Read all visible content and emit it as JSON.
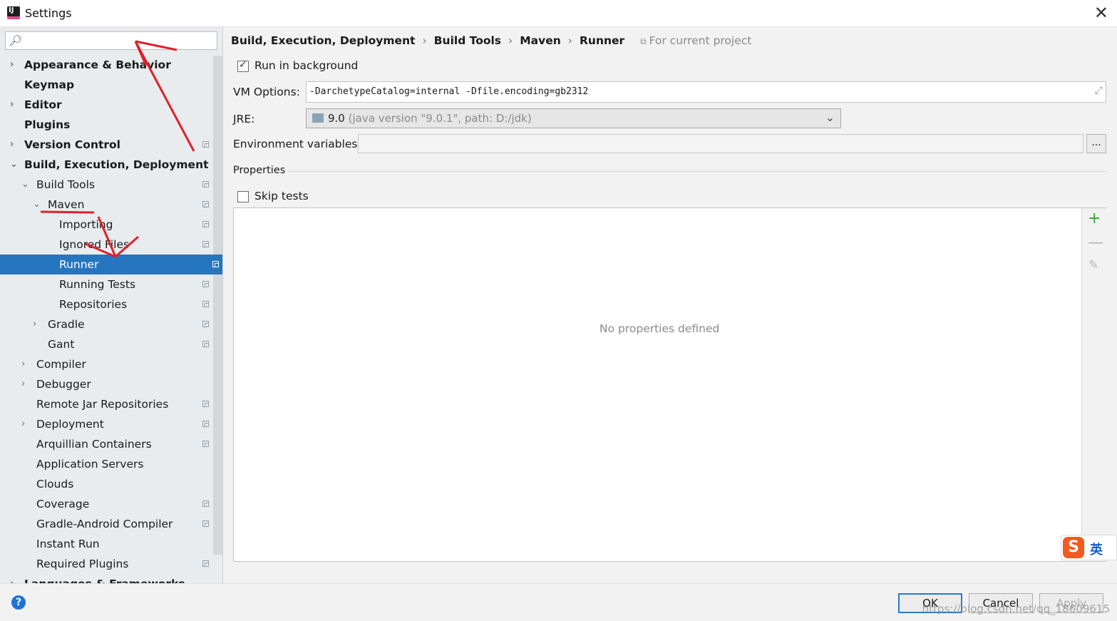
{
  "window": {
    "title": "Settings",
    "close_glyph": "✕"
  },
  "sidebar": {
    "search_placeholder": "",
    "items": [
      {
        "label": "Appearance & Behavior",
        "arrow": "›",
        "bold": true
      },
      {
        "label": "Keymap",
        "bold": true
      },
      {
        "label": "Editor",
        "arrow": "›",
        "bold": true
      },
      {
        "label": "Plugins",
        "bold": true
      },
      {
        "label": "Version Control",
        "arrow": "›",
        "bold": true
      },
      {
        "label": "Build, Execution, Deployment",
        "arrow": "⌄",
        "bold": true
      },
      {
        "label": "Build Tools",
        "arrow": "⌄"
      },
      {
        "label": "Maven",
        "arrow": "⌄"
      },
      {
        "label": "Importing"
      },
      {
        "label": "Ignored Files"
      },
      {
        "label": "Runner",
        "selected": true
      },
      {
        "label": "Running Tests"
      },
      {
        "label": "Repositories"
      },
      {
        "label": "Gradle",
        "arrow": "›"
      },
      {
        "label": "Gant"
      },
      {
        "label": "Compiler",
        "arrow": "›"
      },
      {
        "label": "Debugger",
        "arrow": "›"
      },
      {
        "label": "Remote Jar Repositories"
      },
      {
        "label": "Deployment",
        "arrow": "›"
      },
      {
        "label": "Arquillian Containers"
      },
      {
        "label": "Application Servers"
      },
      {
        "label": "Clouds"
      },
      {
        "label": "Coverage"
      },
      {
        "label": "Gradle-Android Compiler"
      },
      {
        "label": "Instant Run"
      },
      {
        "label": "Required Plugins"
      },
      {
        "label": "Languages & Frameworks",
        "arrow": "›",
        "bold": true
      }
    ]
  },
  "breadcrumb": {
    "parts": [
      "Build, Execution, Deployment",
      "Build Tools",
      "Maven",
      "Runner"
    ],
    "separator": "›",
    "scope": "For current project"
  },
  "runner": {
    "run_in_background_label": "Run in background",
    "run_in_background_checked": true,
    "vm_options_label": "VM Options:",
    "vm_options_value": "-DarchetypeCatalog=internal -Dfile.encoding=gb2312",
    "jre_label": "JRE:",
    "jre_version": "9.0",
    "jre_detail": "(java version \"9.0.1\", path: D:/jdk)",
    "env_label": "Environment variables:",
    "env_value": "",
    "env_button": "...",
    "properties_label": "Properties",
    "skip_tests_label": "Skip tests",
    "skip_tests_checked": false,
    "empty_properties": "No properties defined"
  },
  "buttons": {
    "ok": "OK",
    "cancel": "Cancel",
    "apply": "Apply",
    "help": "?"
  },
  "watermark": "https://blog.csdn.net/qq_18609615",
  "ime": {
    "logo": "S",
    "mode": "英"
  },
  "colors": {
    "selection": "#2675bf",
    "annotation": "#e0202a",
    "add": "#3aa335"
  }
}
